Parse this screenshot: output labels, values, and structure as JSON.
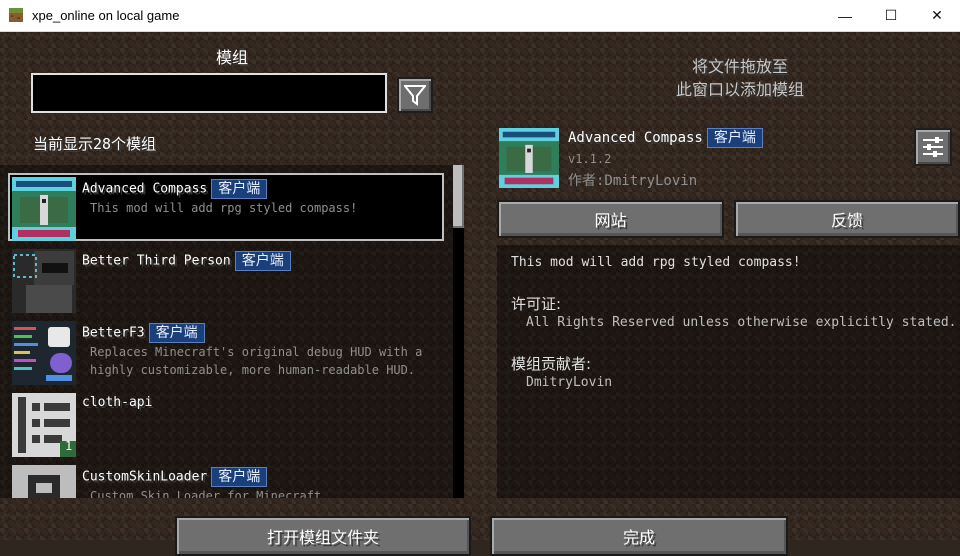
{
  "window": {
    "title": "xpe_online on local game",
    "minimize_glyph": "—",
    "maximize_glyph": "☐",
    "close_glyph": "✕"
  },
  "left": {
    "heading": "模组",
    "search": {
      "value": "",
      "placeholder": ""
    },
    "filter_icon": "filter-funnel-icon",
    "count_text": "当前显示28个模组",
    "mods": [
      {
        "name": "Advanced Compass",
        "badge": "客户端",
        "description": "This mod will add rpg styled compass!",
        "selected": true
      },
      {
        "name": "Better Third Person",
        "badge": "客户端",
        "description": ""
      },
      {
        "name": "BetterF3",
        "badge": "客户端",
        "description": "Replaces Minecraft's original debug HUD with a highly customizable, more human-readable HUD."
      },
      {
        "name": "cloth-api",
        "badge": "",
        "description": "",
        "icon_number": "1"
      },
      {
        "name": "CustomSkinLoader",
        "badge": "客户端",
        "description": "Custom Skin Loader for Minecraft"
      }
    ]
  },
  "right": {
    "drop_hint_line1": "将文件拖放至",
    "drop_hint_line2": "此窗口以添加模组",
    "detail": {
      "name": "Advanced Compass",
      "badge": "客户端",
      "version": "v1.1.2",
      "author": "作者:DmitryLovin",
      "description": "This mod will add rpg styled compass!",
      "license_label": "许可证:",
      "license_value": "All Rights Reserved unless otherwise explicitly stated.",
      "contributors_label": "模组贡献者:",
      "contributors_value": "DmitryLovin"
    },
    "website_label": "网站",
    "feedback_label": "反馈"
  },
  "bottom": {
    "open_folder_label": "打开模组文件夹",
    "done_label": "完成"
  }
}
